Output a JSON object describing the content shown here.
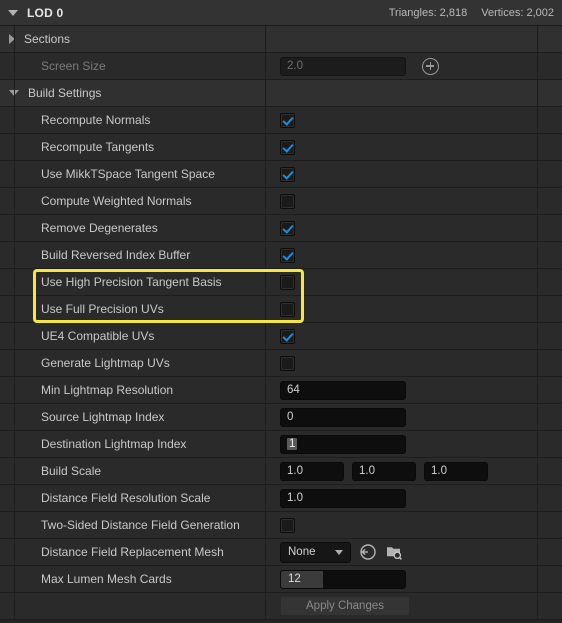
{
  "header": {
    "title": "LOD 0",
    "expand_icon": "triangle-down-icon",
    "triangles_label": "Triangles: 2,818",
    "vertices_label": "Vertices: 2,002"
  },
  "colors": {
    "panel_bg": "#242424",
    "row_bg": "#2a2a2a",
    "category_bg": "#303030",
    "header_bg": "#333333",
    "text": "#c9c9c9",
    "text_dim": "#7c7c7c",
    "checkbox_check": "#1a8fe0",
    "highlight": "#f5e642",
    "field_bg": "#0e0e0e"
  },
  "highlight_annotation": {
    "color": "#f5e642",
    "rows": [
      "Use High Precision Tangent Basis",
      "Use Full Precision UVs"
    ]
  },
  "rows": [
    {
      "id": "sections",
      "kind": "category",
      "label": "Sections",
      "icon": "triangle-right-icon",
      "expanded": false
    },
    {
      "id": "screen-size",
      "kind": "text",
      "label": "Screen Size",
      "disabled": true,
      "value": "2.0",
      "extra_icon": "plus-circle-icon"
    },
    {
      "id": "build-settings",
      "kind": "category",
      "label": "Build Settings",
      "icon": "triangle-down-icon",
      "expanded": true
    },
    {
      "id": "recompute-normals",
      "kind": "checkbox",
      "label": "Recompute Normals",
      "checked": true
    },
    {
      "id": "recompute-tangents",
      "kind": "checkbox",
      "label": "Recompute Tangents",
      "checked": true
    },
    {
      "id": "use-mikktspace-tangent-space",
      "kind": "checkbox",
      "label": "Use MikkTSpace Tangent Space",
      "checked": true
    },
    {
      "id": "compute-weighted-normals",
      "kind": "checkbox",
      "label": "Compute Weighted Normals",
      "checked": false
    },
    {
      "id": "remove-degenerates",
      "kind": "checkbox",
      "label": "Remove Degenerates",
      "checked": true
    },
    {
      "id": "build-reversed-index-buffer",
      "kind": "checkbox",
      "label": "Build Reversed Index Buffer",
      "checked": true
    },
    {
      "id": "use-high-precision-tangent-basis",
      "kind": "checkbox",
      "label": "Use High Precision Tangent Basis",
      "checked": false,
      "highlighted": true
    },
    {
      "id": "use-full-precision-uvs",
      "kind": "checkbox",
      "label": "Use Full Precision UVs",
      "checked": false,
      "highlighted": true
    },
    {
      "id": "ue4-compatible-uvs",
      "kind": "checkbox",
      "label": "UE4 Compatible UVs",
      "checked": true
    },
    {
      "id": "generate-lightmap-uvs",
      "kind": "checkbox",
      "label": "Generate Lightmap UVs",
      "checked": false
    },
    {
      "id": "min-lightmap-resolution",
      "kind": "text",
      "label": "Min Lightmap Resolution",
      "value": "64"
    },
    {
      "id": "source-lightmap-index",
      "kind": "text",
      "label": "Source Lightmap Index",
      "value": "0"
    },
    {
      "id": "destination-lightmap-index",
      "kind": "text",
      "label": "Destination Lightmap Index",
      "value": "1",
      "selected": true
    },
    {
      "id": "build-scale",
      "kind": "vector3",
      "label": "Build Scale",
      "values": [
        "1.0",
        "1.0",
        "1.0"
      ]
    },
    {
      "id": "distance-field-resolution-scale",
      "kind": "text",
      "label": "Distance Field Resolution Scale",
      "value": "1.0"
    },
    {
      "id": "two-sided-distance-field-generation",
      "kind": "checkbox",
      "label": "Two-Sided Distance Field Generation",
      "checked": false
    },
    {
      "id": "distance-field-replacement-mesh",
      "kind": "asset",
      "label": "Distance Field Replacement Mesh",
      "value": "None",
      "icons": [
        "chevron-down-icon",
        "use-selected-asset-icon",
        "browse-asset-icon"
      ]
    },
    {
      "id": "max-lumen-mesh-cards",
      "kind": "slider",
      "label": "Max Lumen Mesh Cards",
      "value": "12"
    },
    {
      "id": "apply-changes",
      "kind": "button",
      "label": "",
      "button_label": "Apply Changes"
    }
  ]
}
